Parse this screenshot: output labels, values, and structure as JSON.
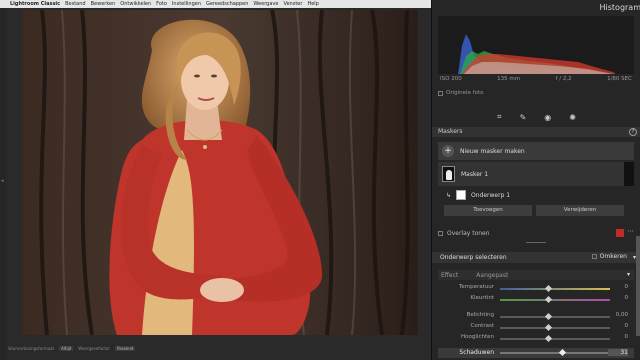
{
  "menubar": {
    "app_name": "Lightroom Classic",
    "items": [
      "Bestand",
      "Bewerken",
      "Ontwikkelen",
      "Foto",
      "Instellingen",
      "Gereedschappen",
      "Weergave",
      "Venster",
      "Help"
    ]
  },
  "filmstrip": {
    "label1": "Voorvertoningsformaat",
    "value1": "Altijd",
    "label2": "Weergavefactor",
    "value2": "Passend"
  },
  "histogram": {
    "title": "Histogram",
    "iso": "ISO 200",
    "focal": "135 mm",
    "aperture": "f / 2,2",
    "shutter": "1/80 SEC",
    "original_label": "Originele foto"
  },
  "tools": [
    "crop-icon",
    "heal-icon",
    "redeye-icon",
    "mask-icon"
  ],
  "masks": {
    "header": "Maskers",
    "new_mask": "Nieuw masker maken",
    "mask1": "Masker 1",
    "sub_mask": "Onderwerp 1",
    "add": "Toevoegen",
    "remove": "Verwijderen",
    "overlay": "Overlay tonen",
    "overlay_color": "#c22a25"
  },
  "subject": {
    "title": "Onderwerp selecteren",
    "invert": "Omkeren"
  },
  "effect": {
    "label": "Effect",
    "value": "Aangepast"
  },
  "sliders": [
    {
      "label": "Temperatuur",
      "value": "0"
    },
    {
      "label": "Kleurtint",
      "value": "0"
    },
    {
      "label": "Belichting",
      "value": "0,00"
    },
    {
      "label": "Contrast",
      "value": "0"
    },
    {
      "label": "Hooglichten",
      "value": "0"
    },
    {
      "label": "Schaduwen",
      "value": "31"
    }
  ],
  "colors": {
    "panel_bg": "#262626",
    "accent_red": "#c22a25",
    "histogram_blue": "#3b63d6",
    "histogram_green": "#2fa84a",
    "histogram_red": "#d83a2f"
  }
}
